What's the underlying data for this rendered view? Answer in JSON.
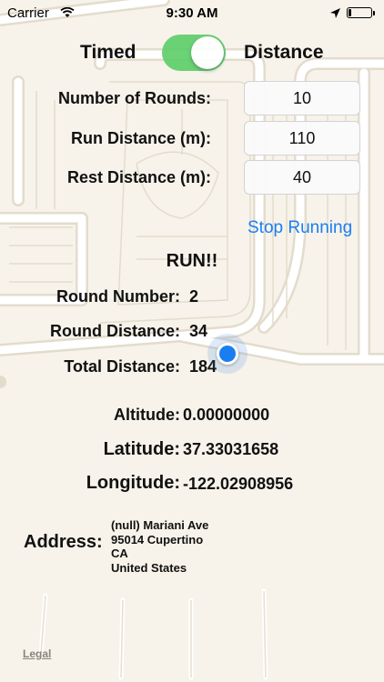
{
  "status_bar": {
    "carrier": "Carrier",
    "time": "9:30 AM",
    "battery_level": 0.12
  },
  "mode_switch": {
    "left_label": "Timed",
    "right_label": "Distance",
    "toggle_on": true,
    "toggle_color": "#5fcf6b"
  },
  "settings": [
    {
      "label": "Number of Rounds:",
      "value": "10"
    },
    {
      "label": "Run Distance (m):",
      "value": "110"
    },
    {
      "label": "Rest Distance (m):",
      "value": "40"
    }
  ],
  "stop_button_label": "Stop Running",
  "run_status": "RUN!!",
  "stats": [
    {
      "label": "Round Number:",
      "value": "2"
    },
    {
      "label": "Round Distance:",
      "value": "34"
    },
    {
      "label": "Total Distance:",
      "value": "184"
    }
  ],
  "location": {
    "altitude_label": "Altitude:",
    "altitude_value": "0.00000000",
    "latitude_label": "Latitude:",
    "latitude_value": "37.33031658",
    "longitude_label": "Longitude:",
    "longitude_value": "-122.02908956"
  },
  "address": {
    "label": "Address:",
    "lines": [
      "(null) Mariani Ave",
      "95014 Cupertino",
      "CA",
      "United States"
    ]
  },
  "map": {
    "legal_label": "Legal",
    "road_color": "#ffffff",
    "road_edge_color": "#e3dccd",
    "highway_color": "#f5d89a"
  },
  "colors": {
    "accent": "#1a7ef2",
    "background": "#f7f3ea"
  }
}
